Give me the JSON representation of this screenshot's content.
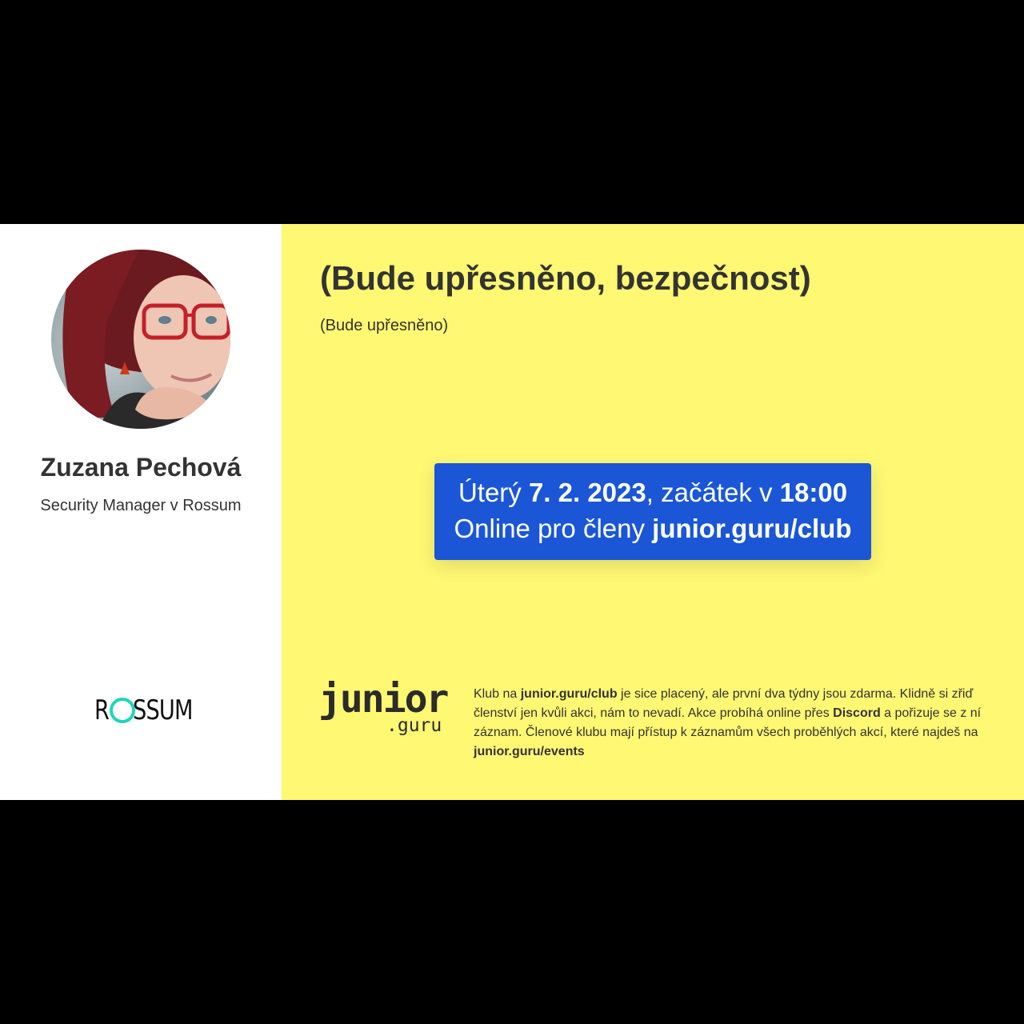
{
  "speaker": {
    "name": "Zuzana Pechová",
    "role": "Security Manager v Rossum",
    "company_logo": {
      "first_letter": "R",
      "rest": "SSUM",
      "accent_color": "#1fd6b8"
    }
  },
  "event": {
    "title": "(Bude upřesněno, bezpečnost)",
    "subtitle": "(Bude upřesněno)",
    "date": {
      "day_prefix": "Úterý ",
      "date": "7. 2. 2023",
      "start_prefix": ", začátek v ",
      "time": "18:00",
      "online_prefix": "Online pro členy ",
      "club_url": "junior.guru/club"
    }
  },
  "footer": {
    "logo": {
      "word": "junior",
      "suffix": ".guru"
    },
    "text": {
      "p1": "Klub na ",
      "club_link": "junior.guru/club",
      "p2": " je sice placený, ale první dva týdny jsou zdarma. Klidně si zřiď členství jen kvůli akci, nám to nevadí. Akce probíhá online přes ",
      "discord": "Discord",
      "p3": " a pořizuje se z ní záznam. Členové klubu mají přístup k záznamům všech proběhlých akcí, které najdeš na ",
      "events_link": "junior.guru/events"
    }
  },
  "colors": {
    "panel_yellow": "#fff873",
    "date_blue": "#1a56d6",
    "letterbox": "#000000"
  }
}
